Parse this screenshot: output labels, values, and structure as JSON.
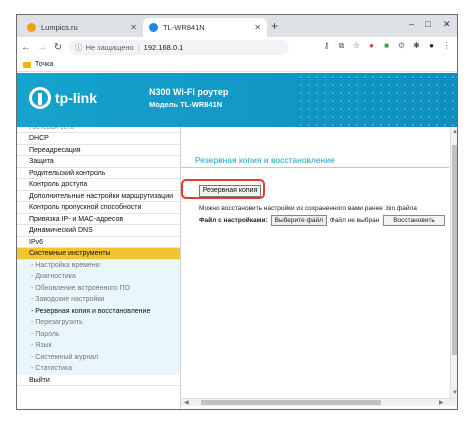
{
  "browser": {
    "tabs": [
      {
        "title": "Lumpics.ru",
        "active": false
      },
      {
        "title": "TL-WR841N",
        "active": true
      }
    ],
    "new_tab": "+",
    "window_controls": {
      "minimize": "–",
      "maximize": "□",
      "close": "✕"
    },
    "address": {
      "security_label": "Не защищено",
      "separator": "|",
      "url": "192.168.0.1"
    },
    "bookmarks": [
      {
        "label": "Точка"
      }
    ]
  },
  "router": {
    "brand": "tp-link",
    "product_line": "N300 Wi-Fi роутер",
    "model_line": "Модель TL-WR841N",
    "menu": {
      "cut_item": "Гостевая сеть",
      "items": [
        "DHCP",
        "Переадресация",
        "Защита",
        "Родительский контроль",
        "Контроль доступа",
        "Дополнительные настройки маршрутизации",
        "Контроль пропускной способности",
        "Привязка IP- и MAC-адресов",
        "Динамический DNS",
        "IPv6"
      ],
      "active_item": "Системные инструменты",
      "sub_items": [
        "- Настройка времени",
        "- Диагностика",
        "- Обновление встроенного ПО",
        "- Заводские настройки",
        "- Резервная копия и восстановление",
        "- Перезагрузить",
        "- Пароль",
        "- Язык",
        "- Системный журнал",
        "- Статистика"
      ],
      "current_sub_index": 4,
      "logout": "Выйти"
    },
    "content": {
      "title": "Резервная копия и восстановление",
      "backup_button": "Резервная копия",
      "restore_hint": "Можно восстановить настройки из сохраненного вами ранее .bin файла",
      "file_label": "Файл с настройками:",
      "choose_file_button": "Выберите файл",
      "no_file_text": "Файл не выбран",
      "restore_button": "Восстановить"
    }
  },
  "colors": {
    "header": "#16a3cc",
    "active_menu": "#f4c430",
    "title": "#1f9ec9",
    "highlight": "#e53935"
  }
}
